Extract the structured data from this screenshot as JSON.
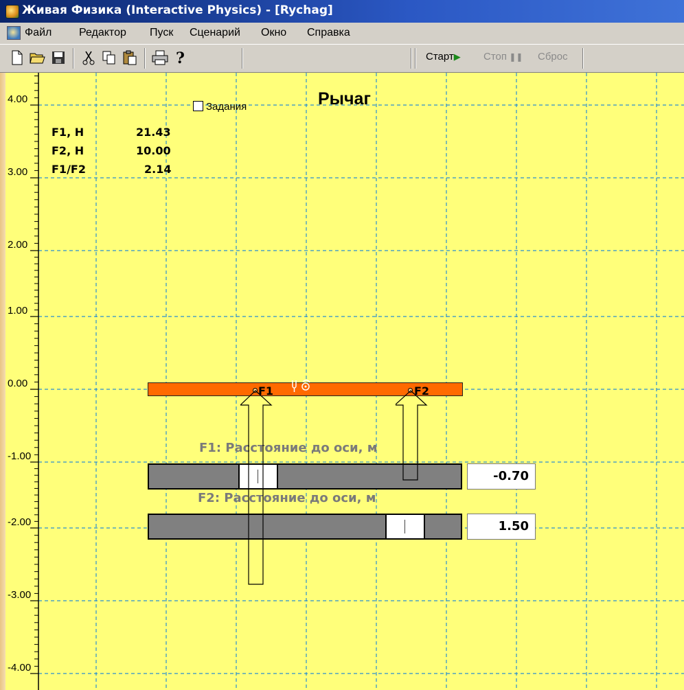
{
  "window": {
    "title": "Живая Физика (Interactive Physics) - [Rychag]"
  },
  "menu": {
    "items": [
      "Файл",
      "Редактор",
      "Пуск",
      "Сценарий",
      "Окно",
      "Справка"
    ]
  },
  "toolbar": {
    "icons": [
      "new-file-icon",
      "open-folder-icon",
      "save-icon",
      "cut-icon",
      "copy-icon",
      "paste-icon",
      "print-icon",
      "help-icon"
    ],
    "start_label": "Старт",
    "stop_label": "Стоп",
    "reset_label": "Сброс"
  },
  "scene": {
    "title": "Рычаг",
    "tasks_label": "Задания",
    "tasks_checked": false,
    "y_axis_labels": [
      "4.00",
      "3.00",
      "2.00",
      "1.00",
      "0.00",
      "-1.00",
      "-2.00",
      "-3.00",
      "-4.00"
    ]
  },
  "meters": [
    {
      "name": "F1, Н",
      "value": "21.43"
    },
    {
      "name": "F2, Н",
      "value": "10.00"
    },
    {
      "name": "F1/F2",
      "value": "2.14"
    }
  ],
  "lever": {
    "point1": "F1",
    "point2": "F2"
  },
  "sliders": [
    {
      "title": "F1: Расстояние до оси, м",
      "value": "-0.70"
    },
    {
      "title": "F2: Расстояние до оси, м",
      "value": "1.50"
    }
  ],
  "colors": {
    "canvas": "#ffff7a",
    "lever": "#ff6a00",
    "grid": "#2a8fd0"
  }
}
